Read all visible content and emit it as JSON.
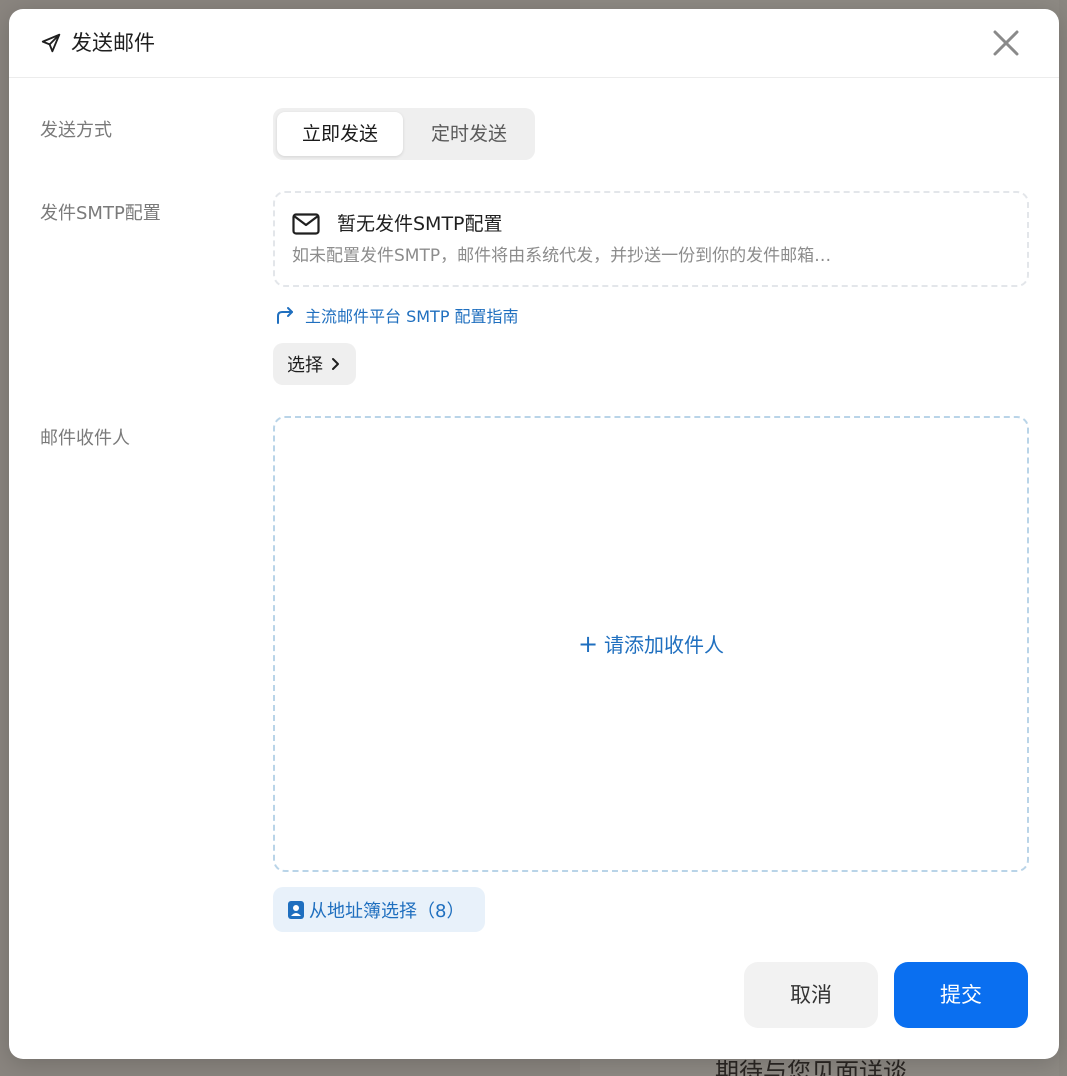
{
  "dialog": {
    "title": "发送邮件",
    "icons": {
      "title": "send-icon",
      "close": "close-icon"
    }
  },
  "send_method": {
    "label": "发送方式",
    "options": [
      {
        "label": "立即发送",
        "selected": true
      },
      {
        "label": "定时发送",
        "selected": false
      }
    ]
  },
  "smtp": {
    "label": "发件SMTP配置",
    "empty_title": "暂无发件SMTP配置",
    "empty_desc": "如未配置发件SMTP，邮件将由系统代发，并抄送一份到你的发件邮箱…",
    "guide_link": "主流邮件平台 SMTP 配置指南",
    "select_button": "选择"
  },
  "recipients": {
    "label": "邮件收件人",
    "add_prompt": "请添加收件人",
    "address_book_button": "从地址簿选择（8）"
  },
  "footer": {
    "cancel": "取消",
    "submit": "提交"
  },
  "colors": {
    "primary": "#0a6ff0",
    "link": "#1f6fbf",
    "recipient_border": "#b9d4e8"
  },
  "backdrop": {
    "footer_text": "期待与您见面详谈"
  }
}
